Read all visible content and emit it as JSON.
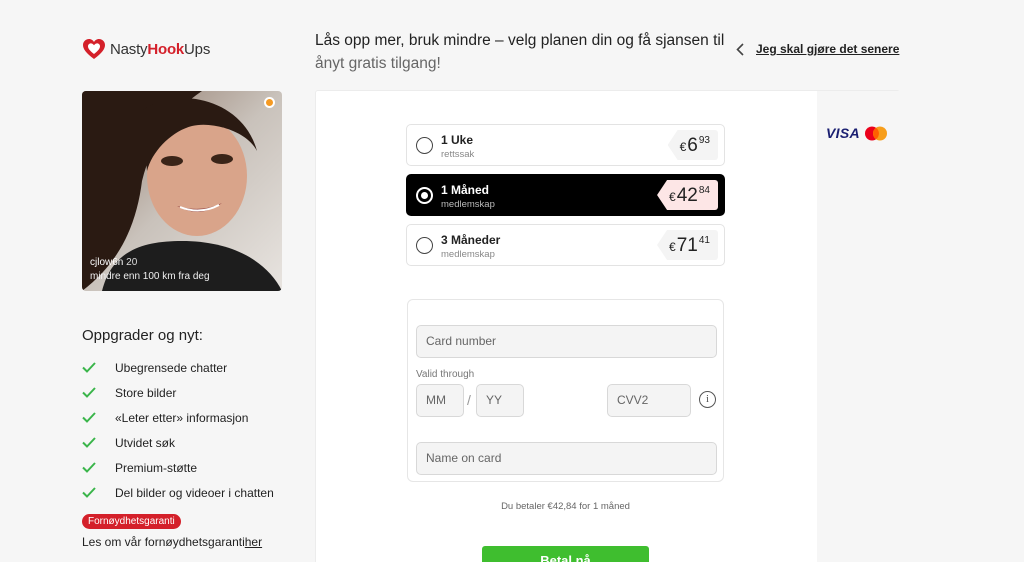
{
  "brand": {
    "prefix": "Nasty",
    "highlight": "Hook",
    "suffix": "Ups"
  },
  "header": {
    "headline_line1": "Lås opp mer, bruk mindre – velg planen din og få sjansen til",
    "headline_line2": "ånyt gratis tilgang!",
    "later_link": "Jeg skal gjøre det senere"
  },
  "profile": {
    "name": "cjlow6n",
    "age": "20",
    "distance": "mindre enn 100 km fra deg",
    "status_color": "#f59a23"
  },
  "upgrade": {
    "title": "Oppgrader og nyt:",
    "features": [
      {
        "label": "Ubegrensede chatter"
      },
      {
        "label": "Store bilder"
      },
      {
        "label": "«Leter etter» informasjon"
      },
      {
        "label": "Utvidet søk"
      },
      {
        "label": "Premium-støtte"
      },
      {
        "label": "Del bilder og videoer i chatten"
      }
    ]
  },
  "guarantee": {
    "badge": "Fornøydhetsgaranti",
    "text": "Les om vår fornøydhetsgaranti",
    "link": "her"
  },
  "payment_brands": {
    "visa": "VISA",
    "mastercard_icon": "mastercard-icon"
  },
  "plans": [
    {
      "name": "1 Uke",
      "sub": "rettssak",
      "currency": "€",
      "price_int": "6",
      "price_dec": "93",
      "selected": false
    },
    {
      "name": "1 Måned",
      "sub": "medlemskap",
      "currency": "€",
      "price_int": "42",
      "price_dec": "84",
      "selected": true
    },
    {
      "name": "3 Måneder",
      "sub": "medlemskap",
      "currency": "€",
      "price_int": "71",
      "price_dec": "41",
      "selected": false
    }
  ],
  "form": {
    "card_number_placeholder": "Card number",
    "valid_through_label": "Valid through",
    "mm_placeholder": "MM",
    "separator": "/",
    "yy_placeholder": "YY",
    "cvv_placeholder": "CVV2",
    "info_glyph": "i",
    "name_placeholder": "Name on card"
  },
  "summary": "Du betaler €42,84 for 1 måned",
  "pay_button": "Betal nå",
  "colors": {
    "brand_red": "#d4202a",
    "pay_green": "#3fbe2f",
    "check_green": "#3ab54a"
  }
}
